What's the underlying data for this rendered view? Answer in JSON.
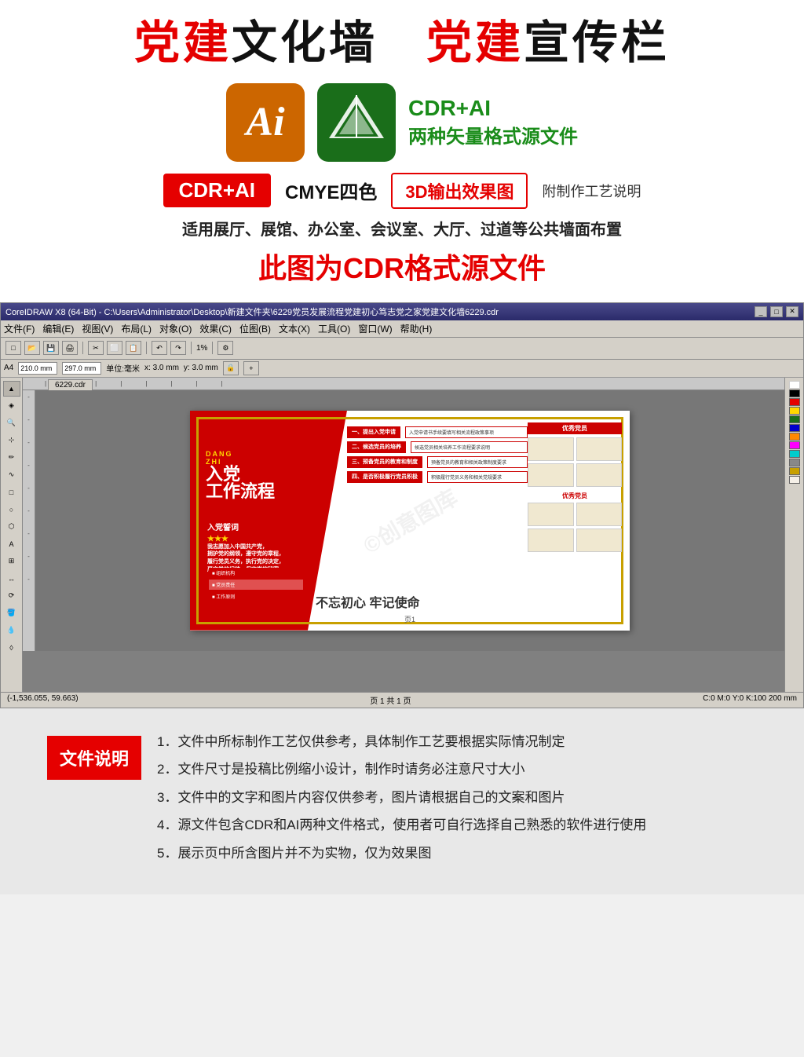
{
  "header": {
    "title_part1": "党建",
    "title_connector1": "文化墙  ",
    "title_part2": "党建",
    "title_connector2": "宣传栏"
  },
  "software": {
    "ai_label": "Ai",
    "cdr_label": "CDR+AI",
    "format_line1": "CDR+AI",
    "format_line2": "两种矢量格式源文件"
  },
  "tags": {
    "tag1": "CDR+AI",
    "tag2": "CMYE四色",
    "tag3": "3D输出效果图",
    "note": "附制作工艺说明"
  },
  "desc": {
    "line1": "适用展厅、展馆、办公室、会议室、大厅、过道等公共墙面布置",
    "line2": "此图为CDR格式源文件"
  },
  "cdr_window": {
    "titlebar": "CoreIDRAW X8 (64-Bit) - C:\\Users\\Administrator\\Desktop\\新建文件夹\\6229党员发展流程党建初心笃志党之家党建文化墙6229.cdr",
    "menu_items": [
      "文件(F)",
      "编辑(E)",
      "视图(V)",
      "布局(L)",
      "对象(O)",
      "效果(C)",
      "位图(B)",
      "文本(X)",
      "工具(O)",
      "窗口(W)",
      "帮助(H)"
    ],
    "tab_label": "6229.cdr",
    "page_label": "页1",
    "statusbar_left": "(-1,536.055, 59.663)",
    "statusbar_right": "C:0 M:0 Y:0 K:100  200 mm"
  },
  "party_wall": {
    "main_title_line1": "入党",
    "main_title_line2": "工作流程",
    "pledge_title": "入党誓词",
    "pledge_stars": "★★★",
    "pledge_text": "我志愿加入中国共产党，拥护党的纲领，遵守党的章程，履行党员义务，执行党的决定...",
    "slogan": "不忘初心 牢记使命",
    "step1": "一、提出入党申请",
    "step2": "二、候选党员的培养",
    "step3": "三、预备党员的教育和制度",
    "step4": "四、是否积极履职党积极",
    "excellent_member": "优秀党员"
  },
  "file_notes": {
    "label": "文件说明",
    "items": [
      "1．文件中所标制作工艺仅供参考，具体制作工艺要根据实际情况制定",
      "2．文件尺寸是投稿比例缩小设计，制作时请务必注意尺寸大小",
      "3．文件中的文字和图片内容仅供参考，图片请根据自己的文案和图片",
      "4．源文件包含CDR和AI两种文件格式，使用者可自行选择自己熟悉的软件进行使用",
      "5．展示页中所含图片并不为实物，仅为效果图"
    ]
  }
}
